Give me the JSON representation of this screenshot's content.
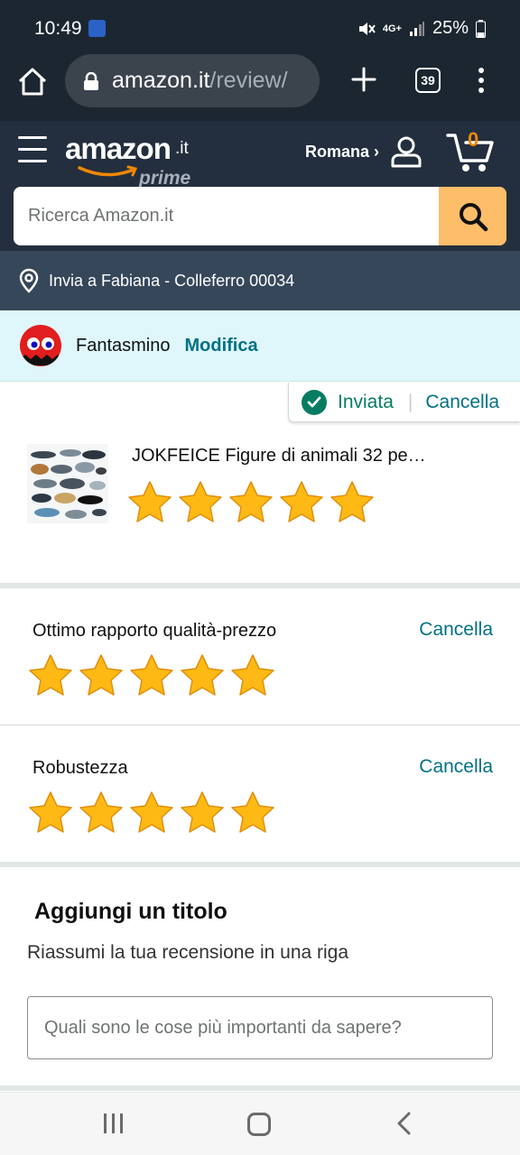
{
  "status_bar": {
    "time": "10:49",
    "battery": "25%",
    "network": "4G+"
  },
  "browser": {
    "url_domain": "amazon.it",
    "url_path": "/review/",
    "tab_count": "39"
  },
  "header": {
    "logo_word": "amazon",
    "logo_tld": ".it",
    "logo_prime": "prime",
    "account_label": "Romana ›",
    "cart_count": "0",
    "accent_color": "#febd69"
  },
  "search": {
    "placeholder": "Ricerca Amazon.it"
  },
  "delivery": {
    "text": "Invia a Fabiana - Colleferro 00034"
  },
  "profile": {
    "name": "Fantasmino",
    "edit_label": "Modifica"
  },
  "review_status": {
    "label": "Inviata",
    "cancel_label": "Cancella"
  },
  "product": {
    "title": "JOKFEICE Figure di animali 32 pe…",
    "rating": 5,
    "max_rating": 5
  },
  "attributes": [
    {
      "label": "Ottimo rapporto qualità-prezzo",
      "rating": 5,
      "cancel_label": "Cancella"
    },
    {
      "label": "Robustezza",
      "rating": 5,
      "cancel_label": "Cancella"
    }
  ],
  "title_section": {
    "heading": "Aggiungi un titolo",
    "subtitle": "Riassumi la tua recensione in una riga",
    "placeholder": "Quali sono le cose più importanti da sapere?"
  },
  "icons": {
    "home": "home-icon",
    "lock": "lock-icon",
    "plus": "plus-icon",
    "tabs": "tabs-icon",
    "menu": "overflow-menu-icon",
    "hamburger": "hamburger-icon",
    "account": "account-icon",
    "cart": "cart-icon",
    "search": "search-icon",
    "location": "location-pin-icon",
    "check": "check-icon",
    "star": "star-icon"
  }
}
